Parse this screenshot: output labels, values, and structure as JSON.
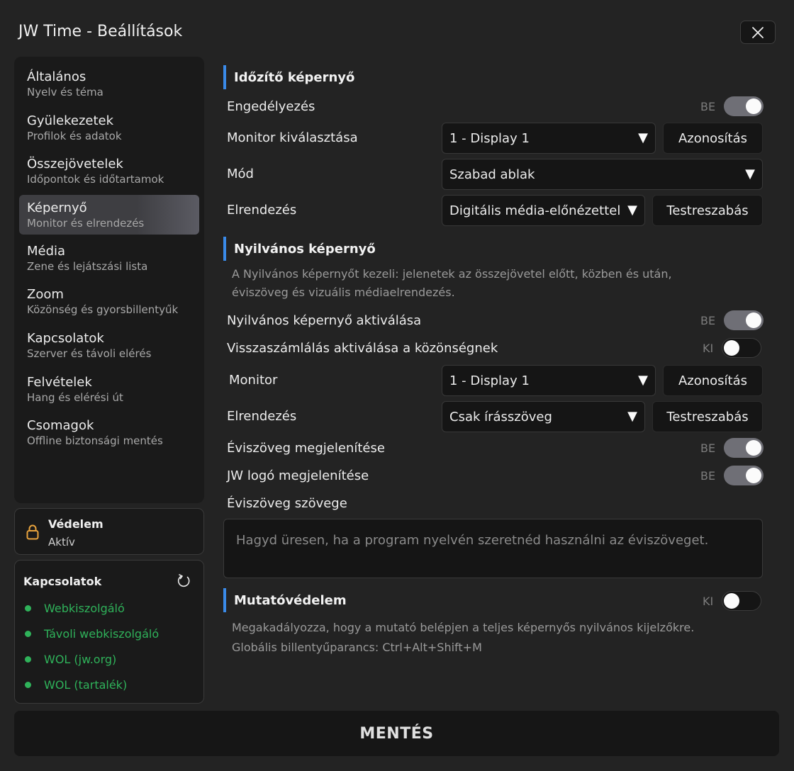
{
  "window": {
    "title": "JW Time - Beállítások"
  },
  "sidebar": {
    "items": [
      {
        "label": "Általános",
        "sub": "Nyelv és téma"
      },
      {
        "label": "Gyülekezetek",
        "sub": "Profilok és adatok"
      },
      {
        "label": "Összejövetelek",
        "sub": "Időpontok és időtartamok"
      },
      {
        "label": "Képernyő",
        "sub": "Monitor és elrendezés",
        "active": true
      },
      {
        "label": "Média",
        "sub": "Zene és lejátszási lista"
      },
      {
        "label": "Zoom",
        "sub": "Közönség és gyorsbillentyűk"
      },
      {
        "label": "Kapcsolatok",
        "sub": "Szerver és távoli elérés"
      },
      {
        "label": "Felvételek",
        "sub": "Hang és elérési út"
      },
      {
        "label": "Csomagok",
        "sub": "Offline biztonsági mentés"
      }
    ]
  },
  "protection": {
    "title": "Védelem",
    "status": "Aktív",
    "icon": "lock-icon",
    "icon_color": "#e8a33d"
  },
  "connections": {
    "title": "Kapcsolatok",
    "status_color": "#2fb25a",
    "items": [
      "Webkiszolgáló",
      "Távoli webkiszolgáló",
      "WOL (jw.org)",
      "WOL (tartalék)"
    ]
  },
  "timer_screen": {
    "title": "Időzítő képernyő",
    "enable": {
      "label": "Engedélyezés",
      "state": "BE",
      "on": true
    },
    "monitor": {
      "label": "Monitor kiválasztása",
      "value": "1 - Display 1",
      "button": "Azonosítás"
    },
    "mode": {
      "label": "Mód",
      "value": "Szabad ablak"
    },
    "layout": {
      "label": "Elrendezés",
      "value": "Digitális média-előnézettel",
      "button": "Testreszabás"
    }
  },
  "public_screen": {
    "title": "Nyilvános képernyő",
    "desc_line1": "A Nyilvános képernyőt kezeli: jelenetek az összejövetel előtt, közben és után,",
    "desc_line2": "éviszöveg és vizuális médiaelrendezés.",
    "activate": {
      "label": "Nyilvános képernyő aktiválása",
      "state": "BE",
      "on": true
    },
    "countdown": {
      "label": "Visszaszámlálás aktiválása a közönségnek",
      "state": "KI",
      "on": false
    },
    "monitor": {
      "label": "Monitor",
      "value": "1 - Display 1",
      "button": "Azonosítás"
    },
    "layout": {
      "label": "Elrendezés",
      "value": "Csak írásszöveg",
      "button": "Testreszabás"
    },
    "yeartext_show": {
      "label": "Éviszöveg megjelenítése",
      "state": "BE",
      "on": true
    },
    "logo_show": {
      "label": "JW logó megjelenítése",
      "state": "BE",
      "on": true
    },
    "yeartext_text": {
      "label": "Éviszöveg szövege",
      "placeholder": "Hagyd üresen, ha a program nyelvén szeretnéd használni az éviszöveget."
    }
  },
  "pointer_protection": {
    "title": "Mutatóvédelem",
    "state": "KI",
    "on": false,
    "desc_line1": "Megakadályozza, hogy a mutató belépjen a teljes képernyős nyilvános kijelzőkre.",
    "desc_line2": "Globális billentyűparancs: Ctrl+Alt+Shift+M"
  },
  "footer": {
    "save_label": "MENTÉS"
  },
  "colors": {
    "accent": "#3a8ae8",
    "background": "#232323",
    "panel": "#1a1a1a"
  }
}
